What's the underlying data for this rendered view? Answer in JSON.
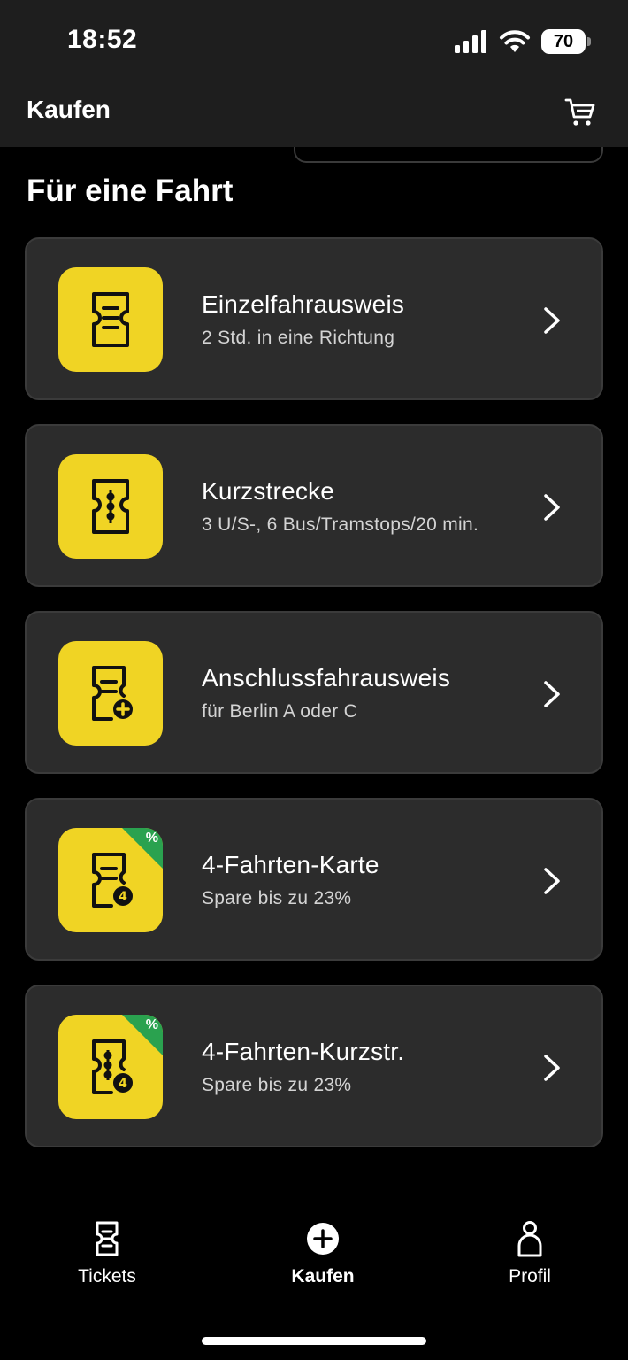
{
  "status_bar": {
    "time": "18:52",
    "battery": "70"
  },
  "header": {
    "title": "Kaufen"
  },
  "section": {
    "title": "Für eine Fahrt"
  },
  "tickets": [
    {
      "title": "Einzelfahrausweis",
      "subtitle": "2 Std. in eine Richtung",
      "icon": "ticket-lines-icon"
    },
    {
      "title": "Kurzstrecke",
      "subtitle": "3 U/S-, 6 Bus/Tramstops/20 min.",
      "icon": "ticket-dots-icon"
    },
    {
      "title": "Anschlussfahrausweis",
      "subtitle": "für Berlin A oder C",
      "icon": "ticket-plus-icon"
    },
    {
      "title": "4-Fahrten-Karte",
      "subtitle": "Spare bis zu 23%",
      "icon": "ticket-four-icon",
      "badge": "%",
      "badge_number": "4"
    },
    {
      "title": "4-Fahrten-Kurzstr.",
      "subtitle": "Spare bis zu 23%",
      "icon": "ticket-dots-four-icon",
      "badge": "%",
      "badge_number": "4"
    }
  ],
  "tabbar": {
    "tickets": "Tickets",
    "kaufen": "Kaufen",
    "profil": "Profil",
    "active": "kaufen"
  },
  "colors": {
    "tile": "#f0d424",
    "card": "#2c2c2c",
    "badge": "#2aa24f",
    "background": "#000000"
  }
}
